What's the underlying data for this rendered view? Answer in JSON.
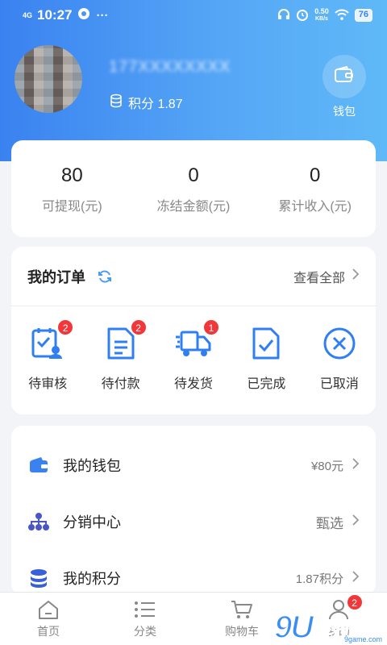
{
  "status_bar": {
    "network": "4G",
    "time": "10:27",
    "speed_value": "0.50",
    "speed_unit": "KB/s",
    "battery": "76"
  },
  "profile": {
    "phone_masked": "177XXXXXXXX",
    "points_label": "积分 1.87",
    "wallet_label": "钱包"
  },
  "stats": [
    {
      "value": "80",
      "label": "可提现(元)"
    },
    {
      "value": "0",
      "label": "冻结金额(元)"
    },
    {
      "value": "0",
      "label": "累计收入(元)"
    }
  ],
  "orders": {
    "title": "我的订单",
    "view_all": "查看全部",
    "items": [
      {
        "label": "待审核",
        "badge": "2",
        "icon": "clipboard-user-icon"
      },
      {
        "label": "待付款",
        "badge": "2",
        "icon": "document-icon"
      },
      {
        "label": "待发货",
        "badge": "1",
        "icon": "truck-icon"
      },
      {
        "label": "已完成",
        "badge": "",
        "icon": "check-document-icon"
      },
      {
        "label": "已取消",
        "badge": "",
        "icon": "cancel-circle-icon"
      }
    ]
  },
  "menu": [
    {
      "label": "我的钱包",
      "value": "¥80元",
      "icon": "wallet-icon"
    },
    {
      "label": "分销中心",
      "value": "甄选",
      "icon": "network-icon"
    },
    {
      "label": "我的积分",
      "value": "1.87积分",
      "icon": "coins-icon"
    }
  ],
  "tabs": [
    {
      "label": "首页",
      "icon": "home-icon"
    },
    {
      "label": "分类",
      "icon": "list-icon"
    },
    {
      "label": "购物车",
      "icon": "cart-icon"
    },
    {
      "label": "我的",
      "icon": "user-icon",
      "badge": "2"
    }
  ],
  "watermark": {
    "main": "9U",
    "text": "游戏",
    "url": "9game.com"
  },
  "colors": {
    "primary": "#3a82f0",
    "badge": "#f2373a",
    "icon_blue": "#2f7ff2"
  }
}
